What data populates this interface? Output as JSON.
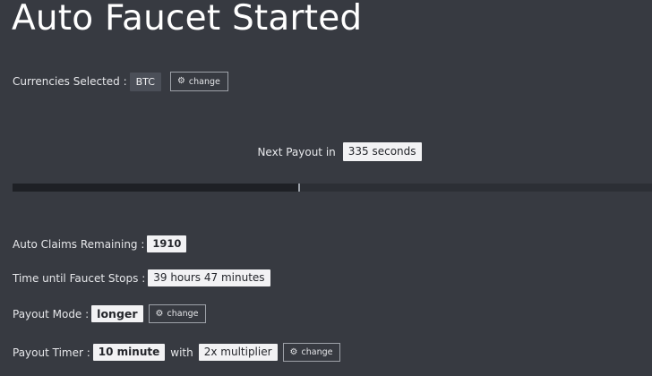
{
  "header": {
    "title": "Auto Faucet Started"
  },
  "currencies": {
    "label": "Currencies Selected :",
    "value": "BTC",
    "change_label": "change"
  },
  "payout": {
    "label": "Next Payout in",
    "value": "335 seconds",
    "progress_fraction": 0.45
  },
  "stats": {
    "claims_label": "Auto Claims Remaining :",
    "claims_value": "1910",
    "stops_label": "Time until Faucet Stops :",
    "stops_value": "39 hours 47 minutes",
    "mode_label": "Payout Mode :",
    "mode_value": "longer",
    "mode_change_label": "change",
    "timer_label": "Payout Timer :",
    "timer_value": "10 minute",
    "timer_with": "with",
    "multiplier_value": "2x multiplier",
    "timer_change_label": "change"
  },
  "icons": {
    "change": "gear-icon"
  }
}
